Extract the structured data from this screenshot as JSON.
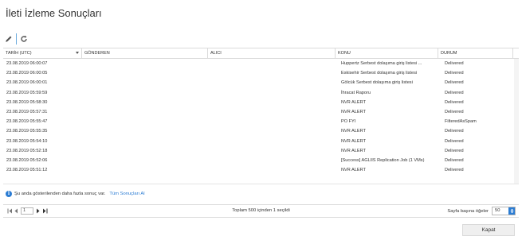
{
  "page": {
    "title": "İleti İzleme Sonuçları"
  },
  "toolbar": {
    "edit_icon": "pencil-icon",
    "refresh_icon": "refresh-icon"
  },
  "grid": {
    "columns": [
      "TARİH (UTC)",
      "GÖNDEREN",
      "ALICI",
      "KONU",
      "DURUM"
    ],
    "rows": [
      {
        "date": "23.08.2019 06:00:07",
        "subject": "Huppertz Serbest dolaşıma giriş listesi ...",
        "status": "Delivered"
      },
      {
        "date": "23.08.2019 06:00:05",
        "subject": "Eskisehir Serbest dolaşıma giriş listesi",
        "status": "Delivered"
      },
      {
        "date": "23.08.2019 06:00:01",
        "subject": "Gölcük Serbest dolaşıma giriş listesi",
        "status": "Delivered"
      },
      {
        "date": "23.08.2019 05:59:59",
        "subject": "İhracat Raporu",
        "status": "Delivered"
      },
      {
        "date": "23.08.2019 05:58:30",
        "subject": "NVR ALERT",
        "status": "Delivered"
      },
      {
        "date": "23.08.2019 05:57:31",
        "subject": "NVR ALERT",
        "status": "Delivered"
      },
      {
        "date": "23.08.2019 05:55:47",
        "subject": "PO FYI",
        "status": "FilteredAsSpam"
      },
      {
        "date": "23.08.2019 05:55:35",
        "subject": "NVR ALERT",
        "status": "Delivered"
      },
      {
        "date": "23.08.2019 05:54:10",
        "subject": "NVR ALERT",
        "status": "Delivered"
      },
      {
        "date": "23.08.2019 05:52:18",
        "subject": "NVR ALERT",
        "status": "Delivered"
      },
      {
        "date": "23.08.2019 05:52:06",
        "subject": "[Success] AGLIIS Replication Job (1 VMs)",
        "status": "Delivered"
      },
      {
        "date": "23.08.2019 05:51:12",
        "subject": "NVR ALERT",
        "status": "Delivered"
      }
    ]
  },
  "info": {
    "icon": "info-icon",
    "message": "Şu anda gösterilenden daha fazla sonuç var.",
    "link": "Tüm Sonuçları Al"
  },
  "pager": {
    "page_value": "1",
    "summary": "Toplam 500 içinden 1 seçildi",
    "per_page_label": "Sayfa başına öğeler",
    "per_page_value": "50"
  },
  "footer": {
    "close_label": "Kapat"
  },
  "colors": {
    "accent": "#2b7cd3",
    "text": "#333333"
  }
}
